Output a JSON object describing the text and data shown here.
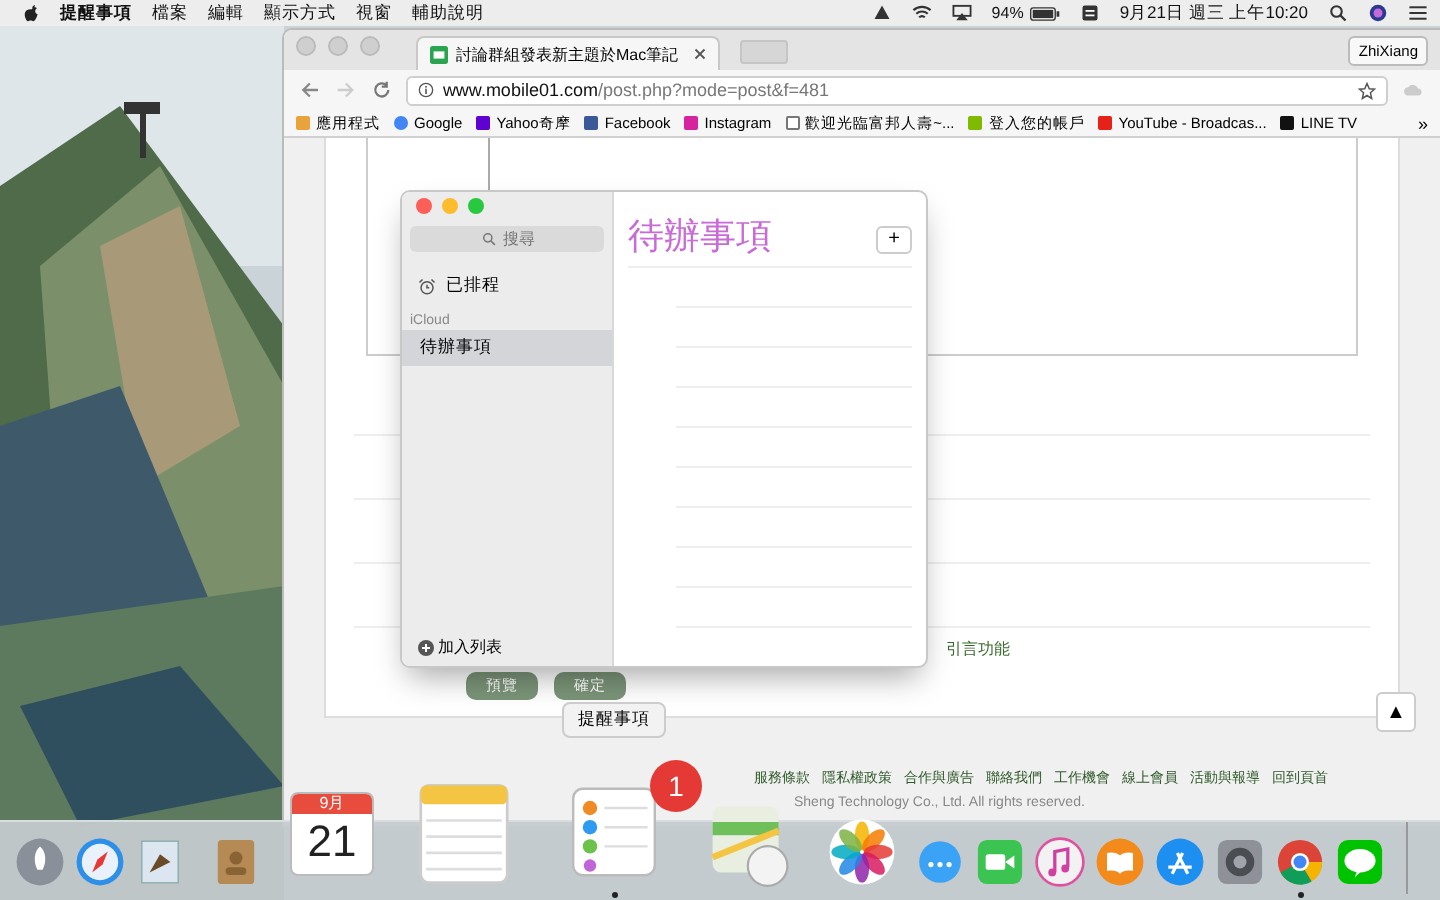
{
  "menu_bar": {
    "app": "提醒事項",
    "items": [
      "檔案",
      "編輯",
      "顯示方式",
      "視窗",
      "輔助說明"
    ],
    "battery_percent": "94%",
    "clock": "9月21日 週三 上午10:20"
  },
  "browser": {
    "tab": {
      "title": "討論群組發表新主題於Mac筆記"
    },
    "profile": "ZhiXiang",
    "address": {
      "host": "www.mobile01.com",
      "path": "/post.php?mode=post&f=481"
    },
    "bookmarks": [
      {
        "kind": "apps",
        "label": "應用程式"
      },
      {
        "kind": "google",
        "label": "Google"
      },
      {
        "kind": "yahoo",
        "label": "Yahoo奇摩"
      },
      {
        "kind": "facebook",
        "label": "Facebook"
      },
      {
        "kind": "instagram",
        "label": "Instagram"
      },
      {
        "kind": "page",
        "label": "歡迎光臨富邦人壽~..."
      },
      {
        "kind": "windows",
        "label": "登入您的帳戶"
      },
      {
        "kind": "youtube",
        "label": "YouTube - Broadcas..."
      },
      {
        "kind": "linetv",
        "label": "LINE TV"
      }
    ],
    "more_bookmarks": "»",
    "page": {
      "quote_label": "引言功能",
      "buttons": [
        "預覽",
        "確定"
      ],
      "scroll_top": "▲",
      "footer_links": [
        "服務條款",
        "隱私權政策",
        "合作與廣告",
        "聯絡我們",
        "工作機會",
        "線上會員",
        "活動與報導",
        "回到頁首"
      ],
      "copyright": "Sheng Technology Co., Ltd. All rights reserved."
    }
  },
  "reminders": {
    "search": {
      "placeholder": "搜尋"
    },
    "scheduled": "已排程",
    "section": "iCloud",
    "lists": [
      {
        "name": "待辦事項",
        "selected": true
      }
    ],
    "add_list": "加入列表",
    "title": "待辦事項",
    "add_button": "+"
  },
  "tooltip": "提醒事項",
  "dock": {
    "items": [
      {
        "kind": "launchpad",
        "running": false
      },
      {
        "kind": "safari",
        "running": false
      },
      {
        "kind": "mail",
        "running": false
      },
      {
        "kind": "contacts",
        "running": false
      },
      {
        "kind": "calendar",
        "month": "9月",
        "day": "21",
        "running": false
      },
      {
        "kind": "notes",
        "running": false
      },
      {
        "kind": "reminders",
        "badge": "1",
        "running": true
      },
      {
        "kind": "maps",
        "running": false
      },
      {
        "kind": "photos",
        "running": false
      },
      {
        "kind": "messages",
        "running": false
      },
      {
        "kind": "facetime",
        "running": false
      },
      {
        "kind": "itunes",
        "running": false
      },
      {
        "kind": "ibooks",
        "running": false
      },
      {
        "kind": "appstore",
        "running": false
      },
      {
        "kind": "sysprefs",
        "running": false
      },
      {
        "kind": "chrome",
        "running": true
      },
      {
        "kind": "line",
        "running": false
      }
    ]
  }
}
